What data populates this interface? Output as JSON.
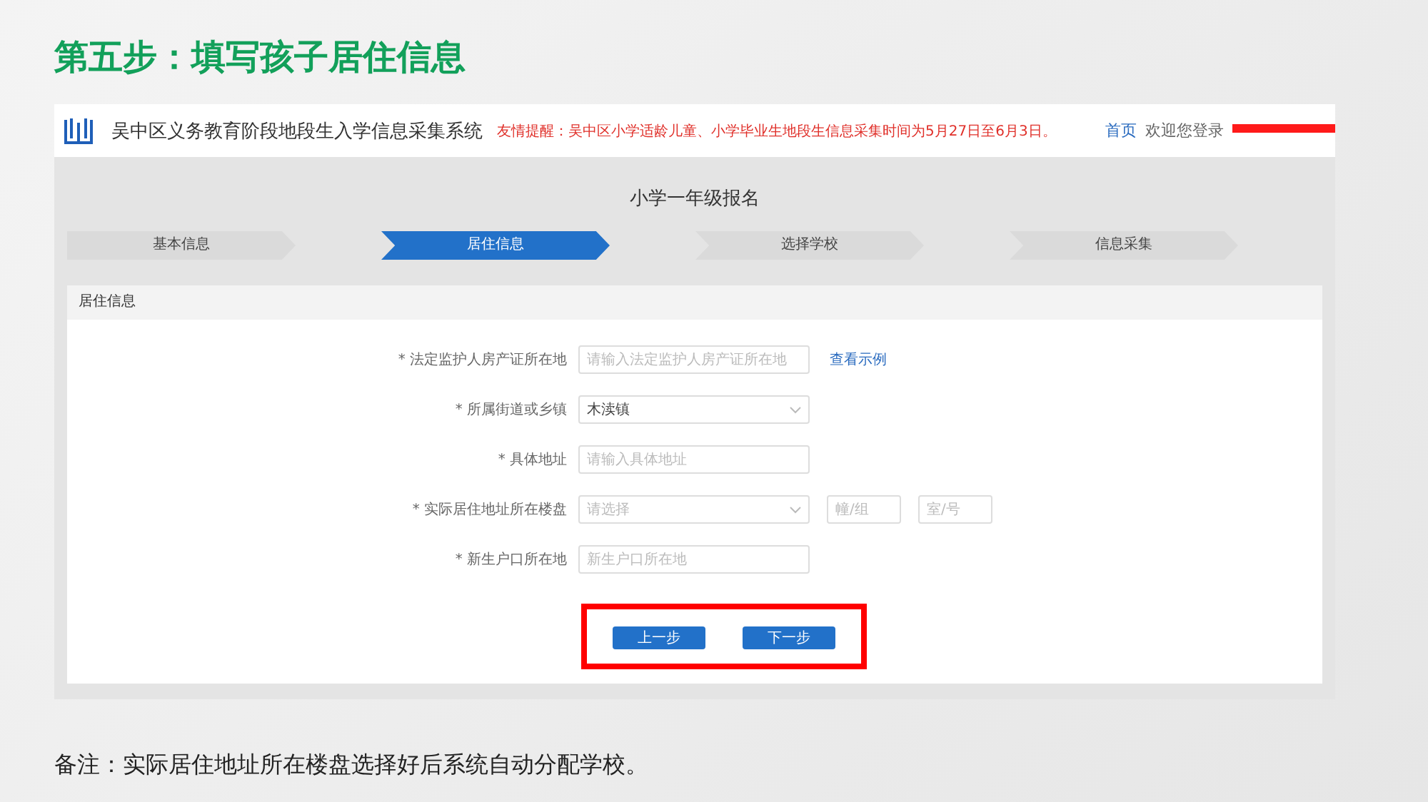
{
  "slide_title": "第五步：填写孩子居住信息",
  "header": {
    "system_name": "吴中区义务教育阶段地段生入学信息采集系统",
    "notice": "友情提醒：吴中区小学适龄儿童、小学毕业生地段生信息采集时间为5月27日至6月3日。",
    "home_link": "首页",
    "welcome": "欢迎您登录",
    "username_redacted": true
  },
  "page_title": "小学一年级报名",
  "steps": [
    {
      "label": "基本信息",
      "selected": false
    },
    {
      "label": "居住信息",
      "selected": true
    },
    {
      "label": "选择学校",
      "selected": false
    },
    {
      "label": "信息采集",
      "selected": false
    }
  ],
  "panel_title": "居住信息",
  "fields": [
    {
      "kind": "input",
      "label": "* 法定监护人房产证所在地",
      "placeholder": "请输入法定监护人房产证所在地",
      "link": "查看示例"
    },
    {
      "kind": "select",
      "label": "* 所属街道或乡镇",
      "value": "木渎镇"
    },
    {
      "kind": "input",
      "label": "* 具体地址",
      "placeholder": "请输入具体地址"
    },
    {
      "kind": "select",
      "label": "* 实际居住地址所在楼盘",
      "placeholder": "请选择",
      "extra": [
        {
          "placeholder": "幢/组"
        },
        {
          "placeholder": "室/号"
        }
      ]
    },
    {
      "kind": "input",
      "label": "* 新生户口所在地",
      "placeholder": "新生户口所在地"
    }
  ],
  "buttons": [
    {
      "label": "上一步"
    },
    {
      "label": "下一步"
    }
  ],
  "highlight_buttons": true,
  "note": "备注：实际居住地址所在楼盘选择好后系统自动分配学校。"
}
